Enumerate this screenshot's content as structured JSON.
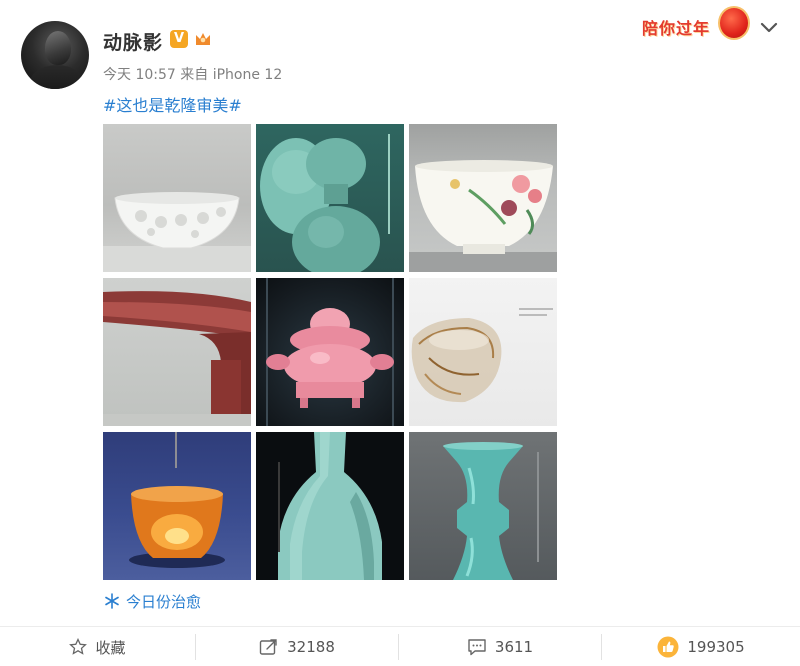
{
  "post": {
    "username": "动脉影",
    "vbadge": "V",
    "time": "今天 10:57",
    "source": "来自 iPhone 12",
    "hashtag": "#这也是乾隆审美#",
    "topic": "今日份治愈"
  },
  "banner": {
    "text": "陪你过年"
  },
  "actions": {
    "favorite": "收藏",
    "repost": "32188",
    "comment": "3611",
    "like": "199305"
  },
  "colors": {
    "link": "#2a7fd0",
    "badge": "#f5a623",
    "like": "#f5a623",
    "banner": "#e33b2e"
  },
  "icons": [
    "crown-icon",
    "chevron-down-icon",
    "star-icon",
    "repost-icon",
    "comment-icon",
    "like-icon",
    "snowflake-icon"
  ],
  "images": [
    "white porcelain bowl",
    "celadon gourd vase",
    "famille-rose floral bowl",
    "red-glazed stem plate",
    "pink crystal covered censer",
    "rutilated crystal cup",
    "amber glowing cup",
    "celadon octagonal vase",
    "turquoise gu vase"
  ]
}
